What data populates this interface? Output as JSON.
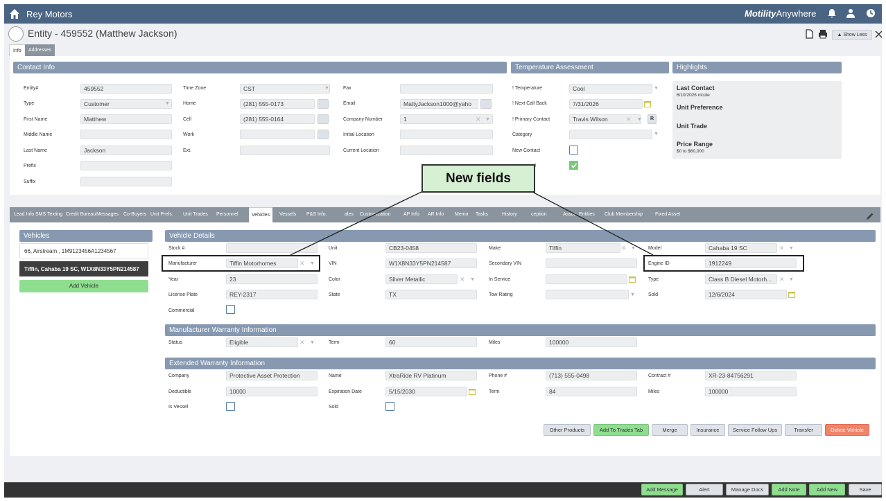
{
  "app": {
    "title": "Rey Motors",
    "brand_strong": "Motility",
    "brand_light": "Anywhere"
  },
  "entity": {
    "title": "Entity - 459552 (Matthew Jackson)",
    "show_less": "Show Less"
  },
  "top_tabs": [
    "Info",
    "Addresses"
  ],
  "contact": {
    "header": "Contact Info",
    "entity_label": "Entity#",
    "entity_value": "459552",
    "type_label": "Type",
    "type_value": "Customer",
    "first_label": "First Name",
    "first_value": "Matthew",
    "middle_label": "Middle Name",
    "middle_value": "",
    "last_label": "Last Name",
    "last_value": "Jackson",
    "prefix_label": "Prefix",
    "suffix_label": "Suffix",
    "tz_label": "Time Zone",
    "tz_value": "CST",
    "home_label": "Home",
    "home_value": "(281) 555-0173",
    "cell_label": "Cell",
    "cell_value": "(281) 555-0164",
    "work_label": "Work",
    "ext_label": "Ext.",
    "fax_label": "Fax",
    "email_label": "Email",
    "email_value": "MattyJackson1000@yaho",
    "company_label": "Company Number",
    "company_value": "1",
    "initloc_label": "Initial Location",
    "curloc_label": "Current Location"
  },
  "temperature": {
    "header": "Temperature Assessment",
    "temp_label": "! Temperature",
    "temp_value": "Cool",
    "next_label": "! Next Call Back",
    "next_value": "7/31/2026",
    "primary_label": "! Primary Contact",
    "primary_value": "Travis Wilson",
    "r_label": "R",
    "category_label": "Category",
    "new_label": "New Contact",
    "d_label": "d"
  },
  "highlights": {
    "header": "Highlights",
    "last_contact": "Last Contact",
    "last_contact_sub": "6/10/2026 nicole",
    "unit_pref": "Unit Preference",
    "unit_trade": "Unit Trade",
    "price_range": "Price Range",
    "price_sub": "$0 to $60,000"
  },
  "sub_tabs": [
    "Lead Info",
    "SMS Texting",
    "Credit Bureau",
    "Messages",
    "Co-Buyers",
    "Unit Prefs.",
    "Unit Trades",
    "Personnel",
    "Vehicles",
    "Vessels",
    "P&S Info.",
    "ales",
    "Customization",
    "AP Info",
    "AR Info",
    "Memo",
    "Tasks",
    "History",
    "ception",
    "Assoc. Entities",
    "Club Membership",
    "Fixed Asset"
  ],
  "vehicles": {
    "header": "Vehicles",
    "items": [
      "66, Airstream , 1M9123456A1234567",
      "Tiffin, Cahaba 19 SC, W1X8N33Y5PN214587"
    ],
    "add": "Add Vehicle"
  },
  "details": {
    "header": "Vehicle Details",
    "stock_label": "Stock #",
    "unit_label": "Unit",
    "unit_value": "CB23-0458",
    "make_label": "Make",
    "make_value": "Tiffin",
    "model_label": "Model",
    "model_value": "Cahaba 19 SC",
    "mfr_label": "Manufacturer",
    "mfr_value": "Tiffin Motorhomes",
    "vin_label": "VIN",
    "vin_value": "W1X8N33Y5PN214587",
    "svin_label": "Secondary VIN",
    "engine_label": "Engine ID",
    "engine_value": "1912249",
    "year_label": "Year",
    "year_value": "23",
    "color_label": "Color",
    "color_value": "Silver Metallic",
    "service_label": "In Service",
    "type_label": "Type",
    "type_value": "Class B Diesel Motorh...",
    "plate_label": "License Plate",
    "plate_value": "REY-2317",
    "state_label": "State",
    "state_value": "TX",
    "tow_label": "Tow Rating",
    "sold_label": "Sold",
    "sold_value": "12/6/2024",
    "commercial_label": "Commercial"
  },
  "mfr_warranty": {
    "header": "Manufacturer Warranty Information",
    "status_label": "Status",
    "status_value": "Eligible",
    "term_label": "Term",
    "term_value": "60",
    "miles_label": "Miles",
    "miles_value": "100000"
  },
  "ext_warranty": {
    "header": "Extended Warranty Information",
    "company_label": "Company",
    "company_value": "Protective Asset Protection",
    "name_label": "Name",
    "name_value": "XtraRide RV Platinum",
    "phone_label": "Phone #",
    "phone_value": "(713) 555-0498",
    "contract_label": "Contract #",
    "contract_value": "XR-23-84756291",
    "deduct_label": "Deductible",
    "deduct_value": "10000",
    "exp_label": "Expiration Date",
    "exp_value": "5/15/2030",
    "term_label": "Term",
    "term_value": "84",
    "miles_label": "Miles",
    "miles_value": "100000",
    "vessel_label": "Is Vessel",
    "sold_label": "Sold"
  },
  "actions": {
    "other": "Other Products",
    "trades": "Add To Trades Tab",
    "merge": "Merge",
    "insurance": "Insurance",
    "service": "Service Follow Ups",
    "transfer": "Transfer",
    "delete": "Delete Vehicle"
  },
  "bottom": {
    "message": "Add Message",
    "alert": "Alert",
    "docs": "Manage Docs",
    "note": "Add Note",
    "new": "Add New",
    "save": "Save"
  },
  "callout": {
    "text": "New fields"
  },
  "colors": {
    "topbar": "#4a6584",
    "section": "#8699b1",
    "green": "#8fde90",
    "red": "#f0836a",
    "callout": "#d6f0d4"
  }
}
